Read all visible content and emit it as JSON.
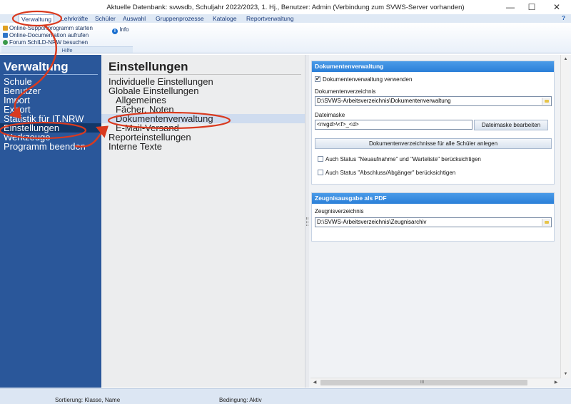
{
  "window": {
    "title": "Aktuelle Datenbank: svwsdb, Schuljahr 2022/2023, 1. Hj., Benutzer: Admin (Verbindung zum SVWS-Server vorhanden)",
    "minimize": "—",
    "maximize": "☐",
    "close": "✕"
  },
  "menubar": {
    "items": [
      "Verwaltung",
      "Lehrkräfte",
      "Schüler",
      "Auswahl",
      "Gruppenprozesse",
      "Kataloge",
      "Reportverwaltung"
    ],
    "help": "?"
  },
  "ribbon": {
    "items": [
      "Online-Supportprogramm starten",
      "Online-Documentation aufrufen",
      "Forum SchILD-NRW besuchen"
    ],
    "info": "Info",
    "info_glyph": "i",
    "group_caption": "Hilfe"
  },
  "left_nav": {
    "title": "Verwaltung",
    "items": [
      "Schule",
      "Benutzer",
      "Import",
      "Export",
      "Statistik für IT.NRW",
      "Einstellungen",
      "Werkzeuge",
      "Programm beenden"
    ],
    "selected_index": 5
  },
  "middle_nav": {
    "title": "Einstellungen",
    "items": [
      "Individuelle Einstellungen",
      "Globale Einstellungen",
      "Allgemeines",
      "Fächer, Noten",
      "Dokumentenverwaltung",
      "E-Mail-Versand",
      "Reporteinstellungen",
      "Interne Texte"
    ],
    "selected_index": 4
  },
  "dokumentenverwaltung": {
    "header": "Dokumentenverwaltung",
    "use_label": "Dokumentenverwaltung verwenden",
    "use_checked": true,
    "dir_label": "Dokumentenverzeichnis",
    "dir_value": "D:\\SVWS-Arbeitsverzeichnis\\Dokumentenverwaltung",
    "mask_label": "Dateimaske",
    "mask_value": "<nvgd>\\<f>_<d>",
    "mask_button": "Dateimaske bearbeiten",
    "create_button": "Dokumentenverzeichnisse für alle Schüler anlegen",
    "opt1_label": "Auch Status \"Neuaufnahme\" und \"Warteliste\" berücksichtigen",
    "opt2_label": "Auch Status \"Abschluss/Abgänger\" berücksichtigen"
  },
  "zeugnisausgabe": {
    "header": "Zeugnisausgabe als PDF",
    "dir_label": "Zeugnisverzeichnis",
    "dir_value": "D:\\SVWS-Arbeitsverzeichnis\\Zeugnisarchiv"
  },
  "statusbar": {
    "sort": "Sortierung: Klasse, Name",
    "condition": "Bedingung: Aktiv"
  },
  "colors": {
    "nav_blue": "#2a579a",
    "nav_selected": "#123768",
    "card_header": "#2b7fd8",
    "annotation_red": "#d93a1f"
  }
}
